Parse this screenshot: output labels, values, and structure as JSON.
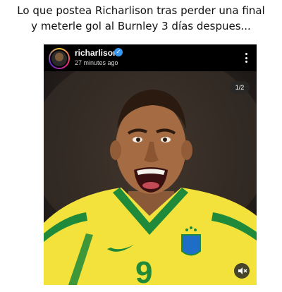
{
  "caption": {
    "line1": "Lo que postea Richarlison tras perder una final",
    "line2": "y meterle gol al Burnley 3 días despues..."
  },
  "post": {
    "username": "richarlison",
    "verified": true,
    "timestamp": "27 minutes ago",
    "media_counter": "1/2",
    "jersey_number": "9"
  },
  "icons": {
    "verified": "verified-badge-icon",
    "more": "more-vertical-icon",
    "mute": "volume-muted-icon"
  },
  "colors": {
    "verified_blue": "#3897f0",
    "jersey_yellow": "#f2e23b",
    "jersey_green": "#1f8a3a"
  }
}
